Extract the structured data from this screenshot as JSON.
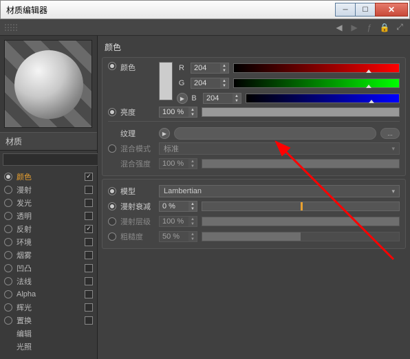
{
  "window": {
    "title": "材质编辑器"
  },
  "sidebar": {
    "mat_label": "材质",
    "mat_name": "",
    "channels": [
      {
        "label": "颜色",
        "active": true,
        "checked": true,
        "has_radio": true,
        "has_chk": true
      },
      {
        "label": "漫射",
        "checked": false,
        "has_radio": true,
        "has_chk": true
      },
      {
        "label": "发光",
        "checked": false,
        "has_radio": true,
        "has_chk": true
      },
      {
        "label": "透明",
        "checked": false,
        "has_radio": true,
        "has_chk": true
      },
      {
        "label": "反射",
        "checked": true,
        "has_radio": true,
        "has_chk": true
      },
      {
        "label": "环境",
        "checked": false,
        "has_radio": true,
        "has_chk": true
      },
      {
        "label": "烟雾",
        "checked": false,
        "has_radio": true,
        "has_chk": true
      },
      {
        "label": "凹凸",
        "checked": false,
        "has_radio": true,
        "has_chk": true
      },
      {
        "label": "法线",
        "checked": false,
        "has_radio": true,
        "has_chk": true
      },
      {
        "label": "Alpha",
        "checked": false,
        "has_radio": true,
        "has_chk": true
      },
      {
        "label": "辉光",
        "checked": false,
        "has_radio": true,
        "has_chk": true
      },
      {
        "label": "置换",
        "checked": false,
        "has_radio": true,
        "has_chk": true
      },
      {
        "label": "编辑",
        "has_radio": false,
        "has_chk": false
      },
      {
        "label": "光照",
        "has_radio": false,
        "has_chk": false
      }
    ]
  },
  "panel": {
    "title": "颜色",
    "color": {
      "label": "颜色",
      "r_label": "R",
      "r_value": "204",
      "g_label": "G",
      "g_value": "204",
      "b_label": "B",
      "b_value": "204",
      "tri_pos_pct": 80
    },
    "brightness": {
      "label": "亮度",
      "value": "100 %",
      "fill_pct": 100
    },
    "texture": {
      "label": "纹理",
      "dots": "..."
    },
    "blend_mode": {
      "label": "混合模式",
      "value": "标准"
    },
    "blend_strength": {
      "label": "混合强度",
      "value": "100 %",
      "fill_pct": 100
    },
    "model": {
      "label": "模型",
      "value": "Lambertian"
    },
    "diffuse_falloff": {
      "label": "漫射衰减",
      "value": "0 %",
      "fill_pct": 0,
      "marker_pct": 50
    },
    "diffuse_level": {
      "label": "漫射层级",
      "value": "100 %",
      "fill_pct": 100
    },
    "roughness": {
      "label": "粗糙度",
      "value": "50 %",
      "fill_pct": 50
    }
  }
}
